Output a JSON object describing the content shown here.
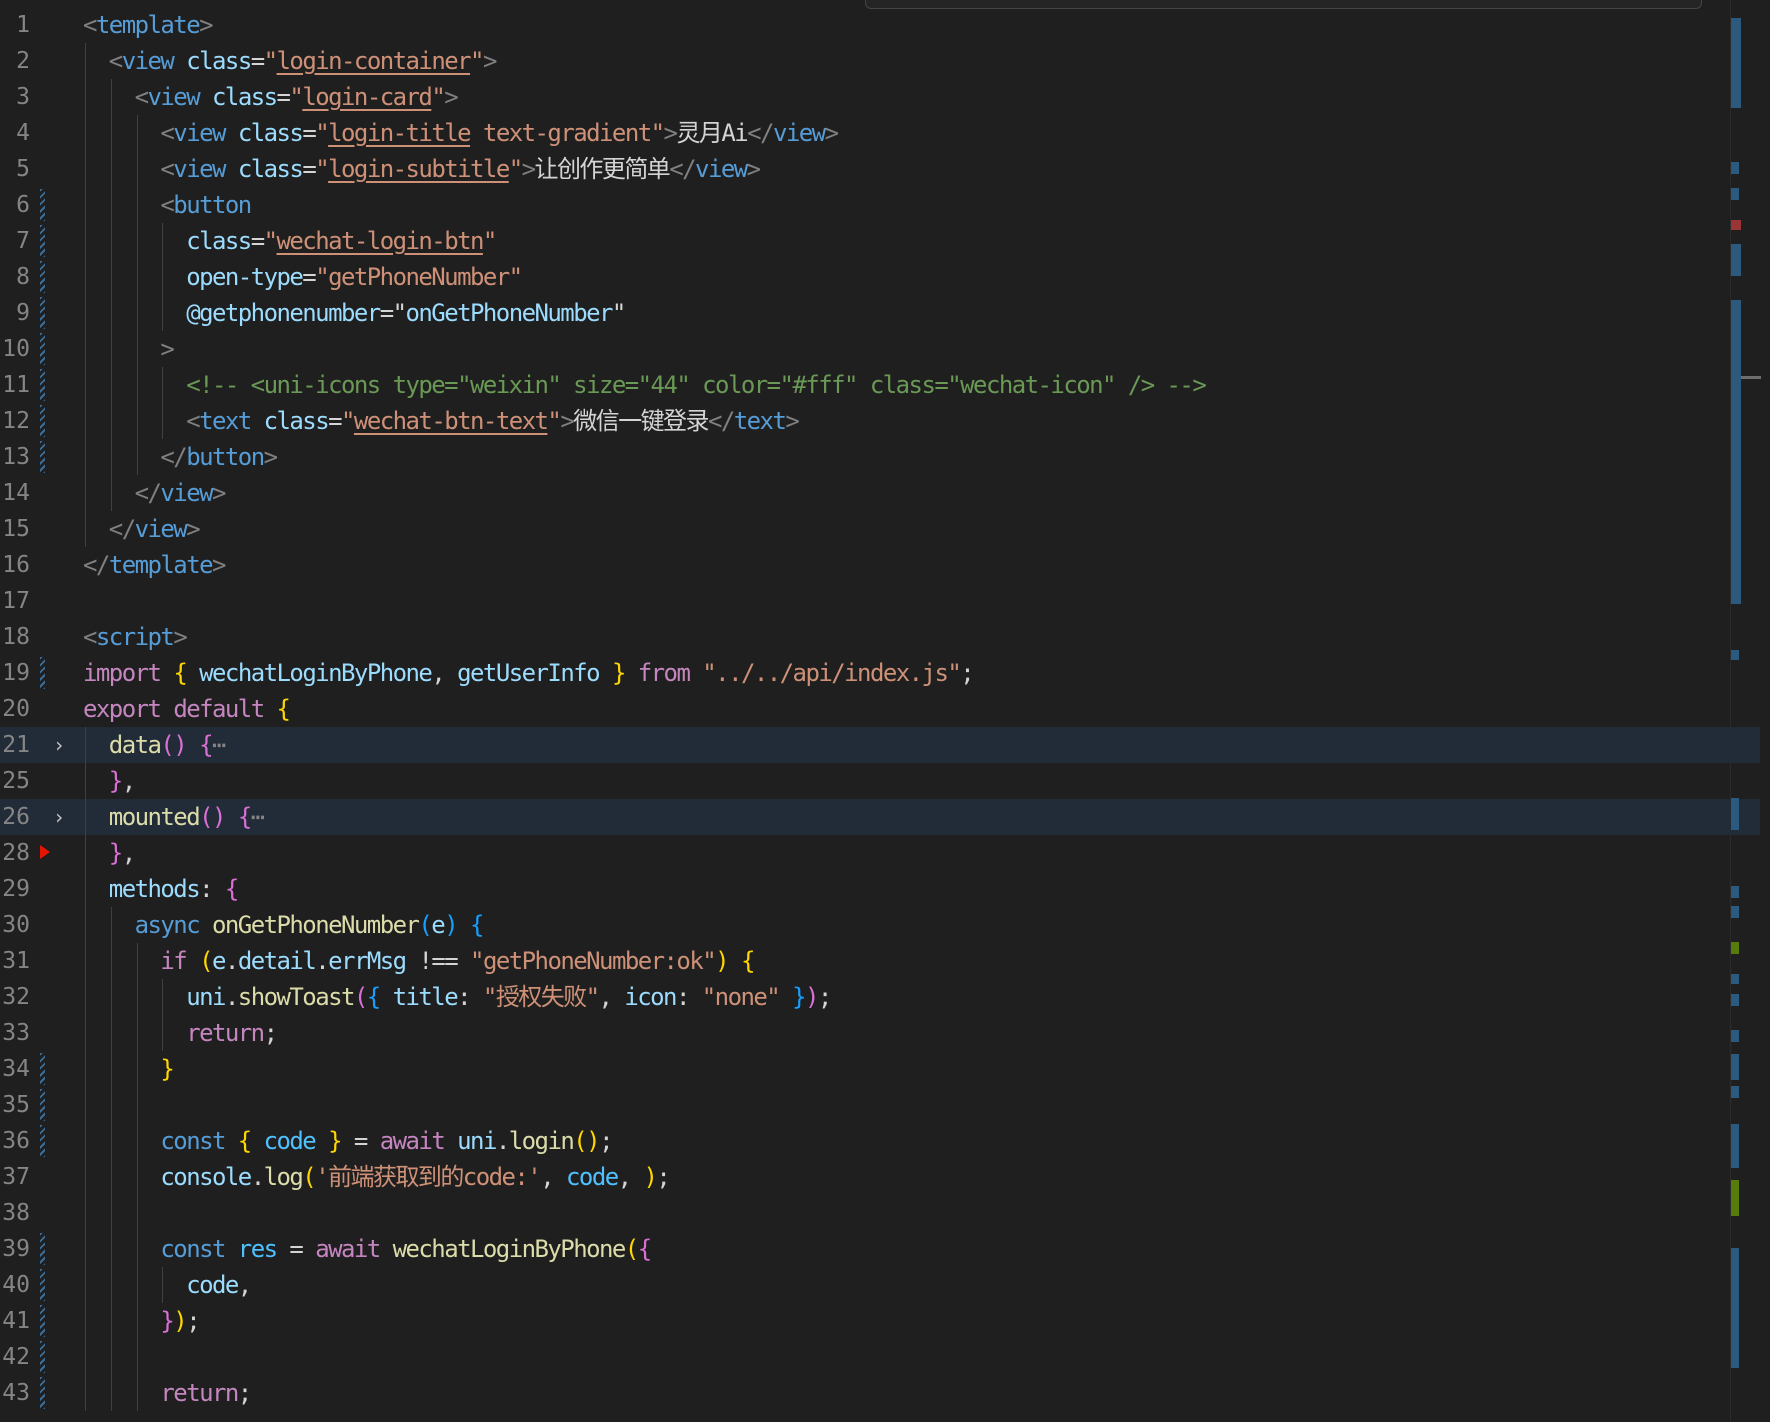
{
  "editor": {
    "language": "vue",
    "lines": [
      {
        "n": "1",
        "indent": 0,
        "tokens": [
          [
            "t-punc",
            "<"
          ],
          [
            "t-tag",
            "template"
          ],
          [
            "t-punc",
            ">"
          ]
        ]
      },
      {
        "n": "2",
        "indent": 1,
        "tokens": [
          [
            "t-punc",
            "<"
          ],
          [
            "t-tag",
            "view"
          ],
          [
            "t-pl",
            " "
          ],
          [
            "t-attr",
            "class"
          ],
          [
            "t-pl",
            "="
          ],
          [
            "t-str",
            "\""
          ],
          [
            "t-link",
            "login-container"
          ],
          [
            "t-str",
            "\""
          ],
          [
            "t-punc",
            ">"
          ]
        ]
      },
      {
        "n": "3",
        "indent": 2,
        "tokens": [
          [
            "t-punc",
            "<"
          ],
          [
            "t-tag",
            "view"
          ],
          [
            "t-pl",
            " "
          ],
          [
            "t-attr",
            "class"
          ],
          [
            "t-pl",
            "="
          ],
          [
            "t-str",
            "\""
          ],
          [
            "t-link",
            "login-card"
          ],
          [
            "t-str",
            "\""
          ],
          [
            "t-punc",
            ">"
          ]
        ]
      },
      {
        "n": "4",
        "indent": 3,
        "tokens": [
          [
            "t-punc",
            "<"
          ],
          [
            "t-tag",
            "view"
          ],
          [
            "t-pl",
            " "
          ],
          [
            "t-attr",
            "class"
          ],
          [
            "t-pl",
            "="
          ],
          [
            "t-str",
            "\""
          ],
          [
            "t-link",
            "login-title"
          ],
          [
            "t-str",
            " text-gradient\""
          ],
          [
            "t-punc",
            ">"
          ],
          [
            "t-text",
            "灵月Ai"
          ],
          [
            "t-punc",
            "</"
          ],
          [
            "t-tag",
            "view"
          ],
          [
            "t-punc",
            ">"
          ]
        ]
      },
      {
        "n": "5",
        "indent": 3,
        "tokens": [
          [
            "t-punc",
            "<"
          ],
          [
            "t-tag",
            "view"
          ],
          [
            "t-pl",
            " "
          ],
          [
            "t-attr",
            "class"
          ],
          [
            "t-pl",
            "="
          ],
          [
            "t-str",
            "\""
          ],
          [
            "t-link",
            "login-subtitle"
          ],
          [
            "t-str",
            "\""
          ],
          [
            "t-punc",
            ">"
          ],
          [
            "t-text",
            "让创作更简单"
          ],
          [
            "t-punc",
            "</"
          ],
          [
            "t-tag",
            "view"
          ],
          [
            "t-punc",
            ">"
          ]
        ]
      },
      {
        "n": "6",
        "indent": 3,
        "tokens": [
          [
            "t-punc",
            "<"
          ],
          [
            "t-tag",
            "button"
          ]
        ]
      },
      {
        "n": "7",
        "indent": 4,
        "tokens": [
          [
            "t-attr",
            "class"
          ],
          [
            "t-pl",
            "="
          ],
          [
            "t-str",
            "\""
          ],
          [
            "t-link",
            "wechat-login-btn"
          ],
          [
            "t-str",
            "\""
          ]
        ]
      },
      {
        "n": "8",
        "indent": 4,
        "tokens": [
          [
            "t-attr",
            "open-type"
          ],
          [
            "t-pl",
            "="
          ],
          [
            "t-str",
            "\"getPhoneNumber\""
          ]
        ]
      },
      {
        "n": "9",
        "indent": 4,
        "tokens": [
          [
            "t-attr",
            "@getphonenumber"
          ],
          [
            "t-pl",
            "=\""
          ],
          [
            "t-var",
            "onGetPhoneNumber"
          ],
          [
            "t-pl",
            "\""
          ]
        ]
      },
      {
        "n": "10",
        "indent": 3,
        "tokens": [
          [
            "t-punc",
            ">"
          ]
        ]
      },
      {
        "n": "11",
        "indent": 4,
        "tokens": [
          [
            "t-cmt",
            "<!-- <uni-icons type=\"weixin\" size=\"44\" color=\"#fff\" class=\"wechat-icon\" /> -->"
          ]
        ]
      },
      {
        "n": "12",
        "indent": 4,
        "tokens": [
          [
            "t-punc",
            "<"
          ],
          [
            "t-tag",
            "text"
          ],
          [
            "t-pl",
            " "
          ],
          [
            "t-attr",
            "class"
          ],
          [
            "t-pl",
            "="
          ],
          [
            "t-str",
            "\""
          ],
          [
            "t-link",
            "wechat-btn-text"
          ],
          [
            "t-str",
            "\""
          ],
          [
            "t-punc",
            ">"
          ],
          [
            "t-text",
            "微信一键登录"
          ],
          [
            "t-punc",
            "</"
          ],
          [
            "t-tag",
            "text"
          ],
          [
            "t-punc",
            ">"
          ]
        ]
      },
      {
        "n": "13",
        "indent": 3,
        "tokens": [
          [
            "t-punc",
            "</"
          ],
          [
            "t-tag",
            "button"
          ],
          [
            "t-punc",
            ">"
          ]
        ]
      },
      {
        "n": "14",
        "indent": 2,
        "tokens": [
          [
            "t-punc",
            "</"
          ],
          [
            "t-tag",
            "view"
          ],
          [
            "t-punc",
            ">"
          ]
        ]
      },
      {
        "n": "15",
        "indent": 1,
        "tokens": [
          [
            "t-punc",
            "</"
          ],
          [
            "t-tag",
            "view"
          ],
          [
            "t-punc",
            ">"
          ]
        ]
      },
      {
        "n": "16",
        "indent": 0,
        "tokens": [
          [
            "t-punc",
            "</"
          ],
          [
            "t-tag",
            "template"
          ],
          [
            "t-punc",
            ">"
          ]
        ]
      },
      {
        "n": "17",
        "indent": 0,
        "tokens": []
      },
      {
        "n": "18",
        "indent": 0,
        "tokens": [
          [
            "t-punc",
            "<"
          ],
          [
            "t-tag",
            "script"
          ],
          [
            "t-punc",
            ">"
          ]
        ]
      },
      {
        "n": "19",
        "indent": 0,
        "tokens": [
          [
            "t-kw",
            "import"
          ],
          [
            "t-pl",
            " "
          ],
          [
            "t-b1",
            "{"
          ],
          [
            "t-pl",
            " "
          ],
          [
            "t-var",
            "wechatLoginByPhone"
          ],
          [
            "t-pl",
            ", "
          ],
          [
            "t-var",
            "getUserInfo"
          ],
          [
            "t-pl",
            " "
          ],
          [
            "t-b1",
            "}"
          ],
          [
            "t-pl",
            " "
          ],
          [
            "t-kw",
            "from"
          ],
          [
            "t-pl",
            " "
          ],
          [
            "t-str",
            "\"../../api/index.js\""
          ],
          [
            "t-pl",
            ";"
          ]
        ]
      },
      {
        "n": "20",
        "indent": 0,
        "tokens": [
          [
            "t-kw",
            "export"
          ],
          [
            "t-pl",
            " "
          ],
          [
            "t-kw",
            "default"
          ],
          [
            "t-pl",
            " "
          ],
          [
            "t-b1",
            "{"
          ]
        ]
      },
      {
        "n": "21",
        "indent": 1,
        "tokens": [
          [
            "t-fn",
            "data"
          ],
          [
            "t-b2",
            "()"
          ],
          [
            "t-pl",
            " "
          ],
          [
            "t-b2",
            "{"
          ],
          [
            "t-fold",
            "⋯"
          ]
        ]
      },
      {
        "n": "25",
        "indent": 1,
        "tokens": [
          [
            "t-b2",
            "}"
          ],
          [
            "t-pl",
            ","
          ]
        ]
      },
      {
        "n": "26",
        "indent": 1,
        "tokens": [
          [
            "t-fn",
            "mounted"
          ],
          [
            "t-b2",
            "()"
          ],
          [
            "t-pl",
            " "
          ],
          [
            "t-b2",
            "{"
          ],
          [
            "t-fold",
            "⋯"
          ]
        ]
      },
      {
        "n": "28",
        "indent": 1,
        "tokens": [
          [
            "t-b2",
            "}"
          ],
          [
            "t-pl",
            ","
          ]
        ]
      },
      {
        "n": "29",
        "indent": 1,
        "tokens": [
          [
            "t-var",
            "methods"
          ],
          [
            "t-pl",
            ": "
          ],
          [
            "t-b2",
            "{"
          ]
        ]
      },
      {
        "n": "30",
        "indent": 2,
        "tokens": [
          [
            "t-dkw",
            "async"
          ],
          [
            "t-pl",
            " "
          ],
          [
            "t-fn",
            "onGetPhoneNumber"
          ],
          [
            "t-b3",
            "("
          ],
          [
            "t-var",
            "e"
          ],
          [
            "t-b3",
            ")"
          ],
          [
            "t-pl",
            " "
          ],
          [
            "t-b3",
            "{"
          ]
        ]
      },
      {
        "n": "31",
        "indent": 3,
        "tokens": [
          [
            "t-kw",
            "if"
          ],
          [
            "t-pl",
            " "
          ],
          [
            "t-b1",
            "("
          ],
          [
            "t-var",
            "e"
          ],
          [
            "t-pl",
            "."
          ],
          [
            "t-var",
            "detail"
          ],
          [
            "t-pl",
            "."
          ],
          [
            "t-var",
            "errMsg"
          ],
          [
            "t-pl",
            " !== "
          ],
          [
            "t-str",
            "\"getPhoneNumber:ok\""
          ],
          [
            "t-b1",
            ")"
          ],
          [
            "t-pl",
            " "
          ],
          [
            "t-b1",
            "{"
          ]
        ]
      },
      {
        "n": "32",
        "indent": 4,
        "tokens": [
          [
            "t-var",
            "uni"
          ],
          [
            "t-pl",
            "."
          ],
          [
            "t-fn",
            "showToast"
          ],
          [
            "t-b2",
            "("
          ],
          [
            "t-b3",
            "{"
          ],
          [
            "t-pl",
            " "
          ],
          [
            "t-var",
            "title"
          ],
          [
            "t-pl",
            ": "
          ],
          [
            "t-str",
            "\"授权失败\""
          ],
          [
            "t-pl",
            ", "
          ],
          [
            "t-var",
            "icon"
          ],
          [
            "t-pl",
            ": "
          ],
          [
            "t-str",
            "\"none\""
          ],
          [
            "t-pl",
            " "
          ],
          [
            "t-b3",
            "}"
          ],
          [
            "t-b2",
            ")"
          ],
          [
            "t-pl",
            ";"
          ]
        ]
      },
      {
        "n": "33",
        "indent": 4,
        "tokens": [
          [
            "t-kw",
            "return"
          ],
          [
            "t-pl",
            ";"
          ]
        ]
      },
      {
        "n": "34",
        "indent": 3,
        "tokens": [
          [
            "t-b1",
            "}"
          ]
        ]
      },
      {
        "n": "35",
        "indent": 3,
        "tokens": []
      },
      {
        "n": "36",
        "indent": 3,
        "tokens": [
          [
            "t-dkw",
            "const"
          ],
          [
            "t-pl",
            " "
          ],
          [
            "t-b1",
            "{"
          ],
          [
            "t-pl",
            " "
          ],
          [
            "t-const",
            "code"
          ],
          [
            "t-pl",
            " "
          ],
          [
            "t-b1",
            "}"
          ],
          [
            "t-pl",
            " = "
          ],
          [
            "t-kw",
            "await"
          ],
          [
            "t-pl",
            " "
          ],
          [
            "t-var",
            "uni"
          ],
          [
            "t-pl",
            "."
          ],
          [
            "t-fn",
            "login"
          ],
          [
            "t-b1",
            "()"
          ],
          [
            "t-pl",
            ";"
          ]
        ]
      },
      {
        "n": "37",
        "indent": 3,
        "tokens": [
          [
            "t-var",
            "console"
          ],
          [
            "t-pl",
            "."
          ],
          [
            "t-fn",
            "log"
          ],
          [
            "t-b1",
            "("
          ],
          [
            "t-str",
            "'前端获取到的code:'"
          ],
          [
            "t-pl",
            ", "
          ],
          [
            "t-const",
            "code"
          ],
          [
            "t-pl",
            ", "
          ],
          [
            "t-b1",
            ")"
          ],
          [
            "t-pl",
            ";"
          ]
        ]
      },
      {
        "n": "38",
        "indent": 3,
        "tokens": []
      },
      {
        "n": "39",
        "indent": 3,
        "tokens": [
          [
            "t-dkw",
            "const"
          ],
          [
            "t-pl",
            " "
          ],
          [
            "t-const",
            "res"
          ],
          [
            "t-pl",
            " = "
          ],
          [
            "t-kw",
            "await"
          ],
          [
            "t-pl",
            " "
          ],
          [
            "t-fn",
            "wechatLoginByPhone"
          ],
          [
            "t-b1",
            "("
          ],
          [
            "t-b2",
            "{"
          ]
        ]
      },
      {
        "n": "40",
        "indent": 4,
        "tokens": [
          [
            "t-var",
            "code"
          ],
          [
            "t-pl",
            ","
          ]
        ]
      },
      {
        "n": "41",
        "indent": 3,
        "tokens": [
          [
            "t-b2",
            "}"
          ],
          [
            "t-b1",
            ")"
          ],
          [
            "t-pl",
            ";"
          ]
        ]
      },
      {
        "n": "42",
        "indent": 3,
        "tokens": []
      },
      {
        "n": "43",
        "indent": 3,
        "tokens": [
          [
            "t-kw",
            "return"
          ],
          [
            "t-pl",
            ";"
          ]
        ]
      }
    ]
  }
}
